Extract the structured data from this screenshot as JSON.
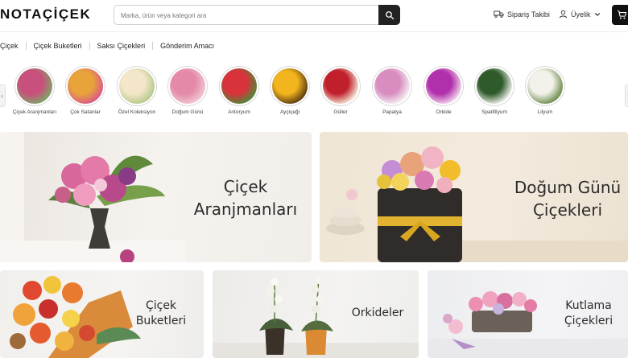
{
  "header": {
    "logo": "NOTAÇİÇEK",
    "search_placeholder": "Marka, ürün veya kategori ara",
    "order_tracking": "Sipariş Takibi",
    "membership": "Üyelik"
  },
  "nav": {
    "items": [
      "Çiçek",
      "Çiçek Buketleri",
      "Saksı Çiçekleri",
      "Gönderim Amacı"
    ]
  },
  "categories": [
    {
      "label": "Çiçek Aranjmanları",
      "colors": [
        "#c94f7c",
        "#7fa66a"
      ]
    },
    {
      "label": "Çok Satanlar",
      "colors": [
        "#e8a33a",
        "#d9588a"
      ]
    },
    {
      "label": "Özel Koleksiyon",
      "colors": [
        "#f4e7c9",
        "#b5c88a"
      ]
    },
    {
      "label": "Doğum Günü",
      "colors": [
        "#e48aa8",
        "#f2c6d2"
      ]
    },
    {
      "label": "Antoryum",
      "colors": [
        "#d8323a",
        "#4f8a3a"
      ]
    },
    {
      "label": "Ayçiçeği",
      "colors": [
        "#f2b51d",
        "#5a3b12"
      ]
    },
    {
      "label": "Güller",
      "colors": [
        "#c0202c",
        "#f5e9d8"
      ]
    },
    {
      "label": "Papatya",
      "colors": [
        "#d88cc0",
        "#f4f0f2"
      ]
    },
    {
      "label": "Orkide",
      "colors": [
        "#b02faa",
        "#f4d8ee"
      ]
    },
    {
      "label": "Spatifilyum",
      "colors": [
        "#2f5a2a",
        "#f4f4f0"
      ]
    },
    {
      "label": "Lilyum",
      "colors": [
        "#f3f2ea",
        "#6a8a4a"
      ]
    }
  ],
  "banners": {
    "b1": "Çiçek Aranjmanları",
    "b2": "Doğum Günü Çiçekleri",
    "b3": "Çiçek Buketleri",
    "b4": "Orkideler",
    "b5": "Kutlama Çiçekleri"
  }
}
